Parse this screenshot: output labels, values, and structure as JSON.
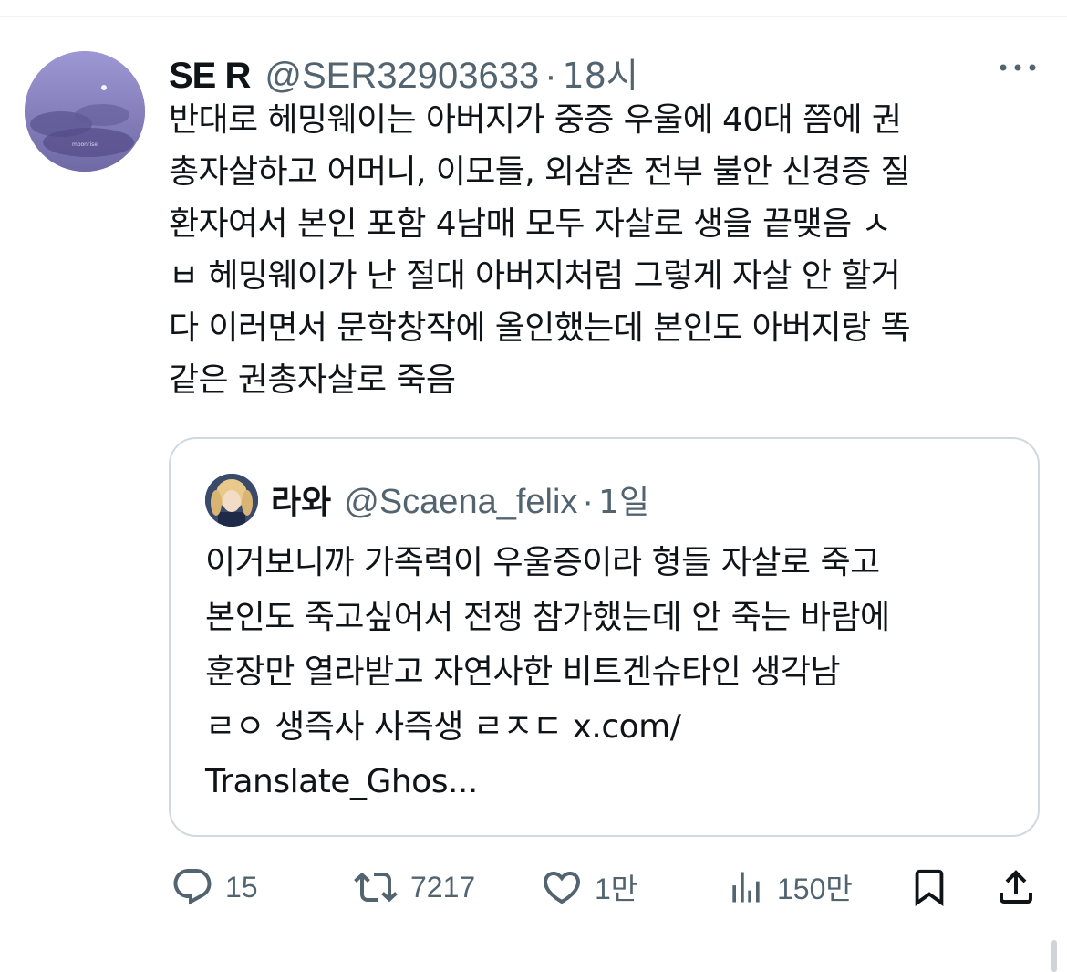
{
  "tweet": {
    "display_name": "SE R",
    "handle": "@SER32903633",
    "separator": "·",
    "time": "18시",
    "text": "반대로 헤밍웨이는 아버지가 중증 우울에 40대 쯤에 권\n총자살하고 어머니, 이모들, 외삼촌 전부 불안 신경증 질\n환자여서 본인 포함 4남매 모두 자살로 생을 끝맺음 ㅅ\nㅂ 헤밍웨이가 난 절대 아버지처럼 그렇게 자살 안 할거\n다 이러면서 문학창작에 올인했는데 본인도 아버지랑 똑\n같은 권총자살로 죽음"
  },
  "quote": {
    "display_name": "라와",
    "handle": "@Scaena_felix",
    "separator": "·",
    "time": "1일",
    "text": "이거보니까 가족력이 우울증이라 형들 자살로 죽고\n본인도 죽고싶어서 전쟁 참가했는데 안 죽는 바람에\n훈장만 열라받고 자연사한 비트겐슈타인 생각남\nㄹㅇ 생즉사 사즉생 ㄹㅈㄷ x.com/\nTranslate_Ghos..."
  },
  "actions": {
    "replies": "15",
    "retweets": "7217",
    "likes": "1만",
    "views": "150만"
  },
  "icons": {
    "more": "more-horizontal-icon",
    "reply": "reply-icon",
    "retweet": "retweet-icon",
    "like": "heart-icon",
    "views": "views-icon",
    "bookmark": "bookmark-icon",
    "share": "share-icon"
  },
  "colors": {
    "text": "#0f1419",
    "secondary": "#536471",
    "border": "#cfd9de"
  }
}
